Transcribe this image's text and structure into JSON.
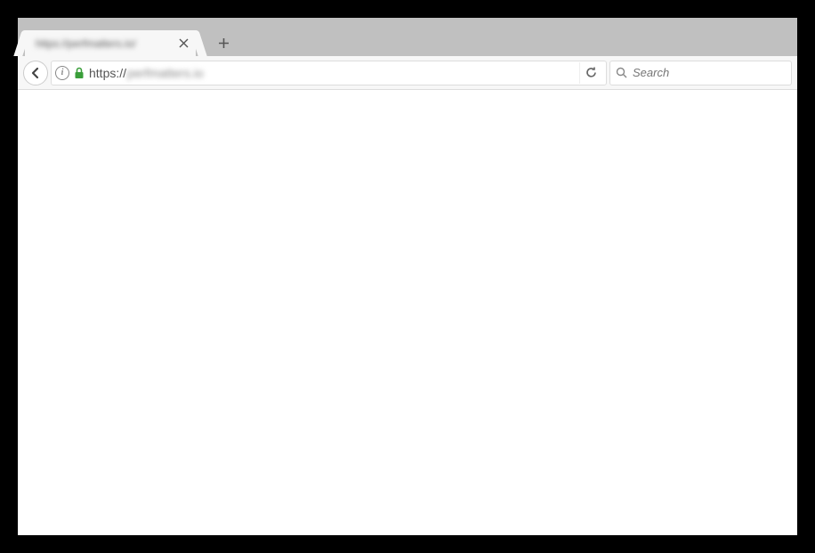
{
  "tab": {
    "title": "https://perfmatters.io/"
  },
  "address": {
    "protocol": "https://",
    "rest": "perfmatters.io"
  },
  "search": {
    "placeholder": "Search"
  }
}
